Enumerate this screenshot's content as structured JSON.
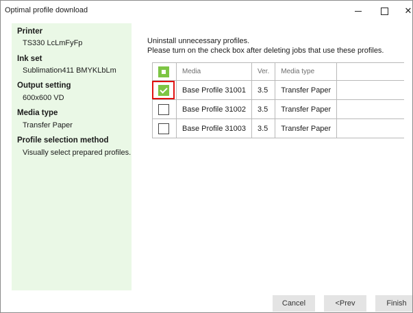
{
  "window": {
    "title": "Optimal profile download",
    "controls": {
      "minimize": "minimize",
      "maximize": "maximize",
      "close": "✕"
    }
  },
  "sidebar": {
    "printer_label": "Printer",
    "printer_value": "TS330 LcLmFyFp",
    "ink_label": "Ink set",
    "ink_value": "Sublimation411 BMYKLbLm",
    "output_label": "Output setting",
    "output_value": "600x600 VD",
    "media_label": "Media type",
    "media_value": "Transfer Paper",
    "method_label": "Profile selection method",
    "method_value": "Visually select prepared profiles."
  },
  "instructions": {
    "line1": "Uninstall unnecessary profiles.",
    "line2": "Please turn on the check box after deleting jobs that use these profiles."
  },
  "table": {
    "headers": {
      "media": "Media",
      "ver": "Ver.",
      "media_type": "Media type"
    },
    "rows": [
      {
        "media": "Base Profile 31001",
        "ver": "3.5",
        "media_type": "Transfer Paper",
        "checked": true
      },
      {
        "media": "Base Profile 31002",
        "ver": "3.5",
        "media_type": "Transfer Paper",
        "checked": false
      },
      {
        "media": "Base Profile 31003",
        "ver": "3.5",
        "media_type": "Transfer Paper",
        "checked": false
      }
    ]
  },
  "footer": {
    "cancel": "Cancel",
    "prev": "<Prev",
    "finish": "Finish"
  },
  "colors": {
    "accent_green": "#7dc544",
    "sidebar_bg": "#eaf8e6",
    "highlight_red": "#e01010"
  }
}
